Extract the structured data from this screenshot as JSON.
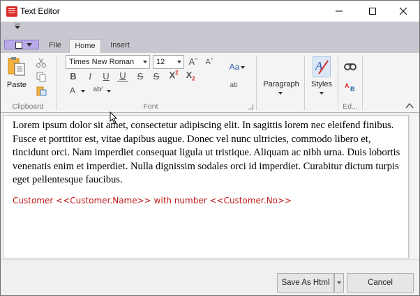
{
  "window": {
    "title": "Text Editor"
  },
  "ribbon": {
    "tabs": [
      "File",
      "Home",
      "Insert"
    ],
    "clipboard": {
      "paste_label": "Paste",
      "group_label": "Clipboard"
    },
    "font": {
      "font_name": "Times New Roman",
      "font_size": "12",
      "group_label": "Font"
    },
    "paragraph": {
      "label": "Paragraph"
    },
    "styles": {
      "label": "Styles"
    },
    "editing": {
      "group_label": "Ed..."
    }
  },
  "document": {
    "body": "Lorem ipsum dolor sit amet, consectetur adipiscing elit. In sagittis lorem nec eleifend finibus. Fusce et porttitor est, vitae dapibus augue. Donec vel nunc ultricies, commodo libero et, tincidunt orci. Nam imperdiet consequat ligula ut tristique. Aliquam ac nibh urna. Duis lobortis venenatis enim et imperdiet. Nulla dignissim sodales orci id imperdiet. Curabitur dictum turpis eget pellentesque faucibus.",
    "merge_line": "Customer <<Customer.Name>> with number <<Customer.No>>"
  },
  "footer": {
    "save_label": "Save As Html",
    "cancel_label": "Cancel"
  },
  "colors": {
    "merge_text": "#c01a1a",
    "accent": "#d9302c",
    "ribbon_bg": "#c8c8d0"
  }
}
